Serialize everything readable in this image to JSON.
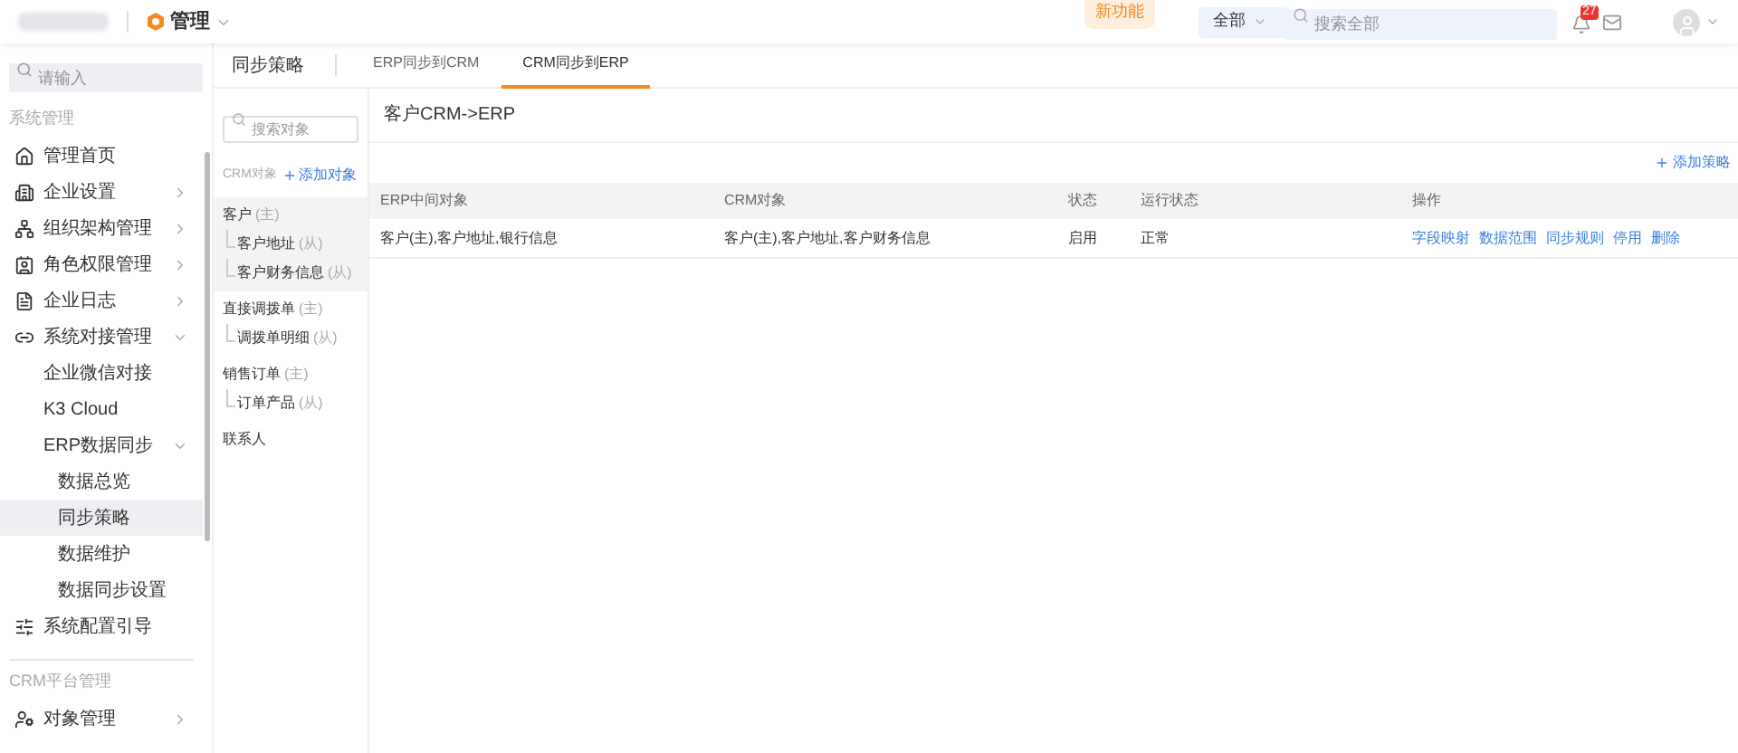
{
  "top_bar": {
    "module": "管理",
    "badge": "新功能",
    "search_scope": "全部",
    "search_placeholder": "搜索全部",
    "notification_count": "27"
  },
  "sidebar": {
    "search_placeholder": "请输入",
    "sections": [
      {
        "title": "系统管理",
        "items": [
          {
            "label": "管理首页",
            "selected": false
          },
          {
            "label": "企业设置",
            "expanded": false,
            "selected": false
          },
          {
            "label": "组织架构管理",
            "expanded": false,
            "selected": false
          },
          {
            "label": "角色权限管理",
            "expanded": false,
            "selected": false
          },
          {
            "label": "企业日志",
            "expanded": false,
            "selected": false
          },
          {
            "label": "系统对接管理",
            "expanded": true,
            "selected": false,
            "children": [
              {
                "label": "企业微信对接",
                "selected": false
              },
              {
                "label": "K3 Cloud",
                "selected": false
              },
              {
                "label": "ERP数据同步",
                "expanded": true,
                "selected": false,
                "children": [
                  {
                    "label": "数据总览",
                    "selected": false
                  },
                  {
                    "label": "同步策略",
                    "selected": true
                  },
                  {
                    "label": "数据维护",
                    "selected": false
                  },
                  {
                    "label": "数据同步设置",
                    "selected": false
                  }
                ]
              }
            ]
          },
          {
            "label": "系统配置引导",
            "selected": false
          }
        ]
      },
      {
        "title": "CRM平台管理",
        "items": [
          {
            "label": "对象管理",
            "expanded": false,
            "selected": false
          }
        ]
      }
    ]
  },
  "page": {
    "title": "同步策略",
    "tabs": [
      {
        "label": "ERP同步到CRM",
        "selected": false
      },
      {
        "label": "CRM同步到ERP",
        "selected": true
      }
    ]
  },
  "object_panel": {
    "search_placeholder": "搜索对象",
    "label": "CRM对象",
    "add_label": "添加对象",
    "objects": [
      {
        "name": "客户",
        "role": "(主)",
        "selected": true,
        "children": [
          {
            "name": "客户地址",
            "role": "(从)"
          },
          {
            "name": "客户财务信息",
            "role": "(从)"
          }
        ]
      },
      {
        "name": "直接调拨单",
        "role": "(主)",
        "selected": false,
        "children": [
          {
            "name": "调拨单明细",
            "role": "(从)"
          }
        ]
      },
      {
        "name": "销售订单",
        "role": "(主)",
        "selected": false,
        "children": [
          {
            "name": "订单产品",
            "role": "(从)"
          }
        ]
      },
      {
        "name": "联系人",
        "selected": false
      }
    ]
  },
  "strategy": {
    "title": "客户CRM->ERP",
    "add_label": "添加策略",
    "table": {
      "columns": [
        "ERP中间对象",
        "CRM对象",
        "状态",
        "运行状态",
        "操作"
      ],
      "rows": [
        {
          "erp_object": "客户(主),客户地址,银行信息",
          "crm_object": "客户(主),客户地址,客户财务信息",
          "status": "启用",
          "run_status": "正常",
          "actions": [
            "字段映射",
            "数据范围",
            "同步规则",
            "停用",
            "删除"
          ]
        }
      ]
    }
  }
}
